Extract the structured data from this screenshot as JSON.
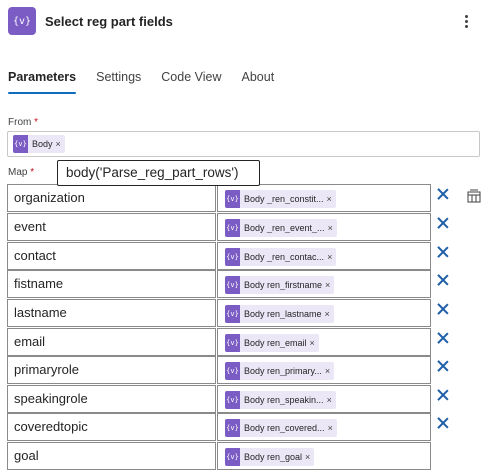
{
  "header": {
    "icon_glyph": "{v}",
    "title": "Select reg part fields",
    "more_icon": "more-vertical-icon"
  },
  "tabs": [
    {
      "label": "Parameters",
      "active": true
    },
    {
      "label": "Settings",
      "active": false
    },
    {
      "label": "Code View",
      "active": false
    },
    {
      "label": "About",
      "active": false
    }
  ],
  "from": {
    "label": "From",
    "required_mark": "*",
    "token": {
      "icon_glyph": "{v}",
      "text": "Body",
      "remove": "×"
    }
  },
  "map": {
    "label": "Map",
    "required_mark": "*",
    "tooltip": "body('Parse_reg_part_rows')",
    "switch_icon": "switch-to-text-mode-icon",
    "rows": [
      {
        "key": "organization",
        "token_text": "Body _ren_constit...",
        "remove": "×"
      },
      {
        "key": "event",
        "token_text": "Body _ren_event_...",
        "remove": "×"
      },
      {
        "key": "contact",
        "token_text": "Body _ren_contac...",
        "remove": "×"
      },
      {
        "key": "fistname",
        "token_text": "Body ren_firstname",
        "remove": "×"
      },
      {
        "key": "lastname",
        "token_text": "Body ren_lastname",
        "remove": "×"
      },
      {
        "key": "email",
        "token_text": "Body ren_email",
        "remove": "×"
      },
      {
        "key": "primaryrole",
        "token_text": "Body ren_primary...",
        "remove": "×"
      },
      {
        "key": "speakingrole",
        "token_text": "Body ren_speakin...",
        "remove": "×"
      },
      {
        "key": "coveredtopic",
        "token_text": "Body ren_covered...",
        "remove": "×"
      },
      {
        "key": "goal",
        "token_text": "Body ren_goal",
        "remove": "×"
      }
    ]
  },
  "colors": {
    "accent": "#7b5cc4",
    "token_bg": "#ece7f7",
    "tab_underline": "#0f6cbd",
    "delete_icon": "#1f5fa8",
    "required": "#c50f1f"
  }
}
